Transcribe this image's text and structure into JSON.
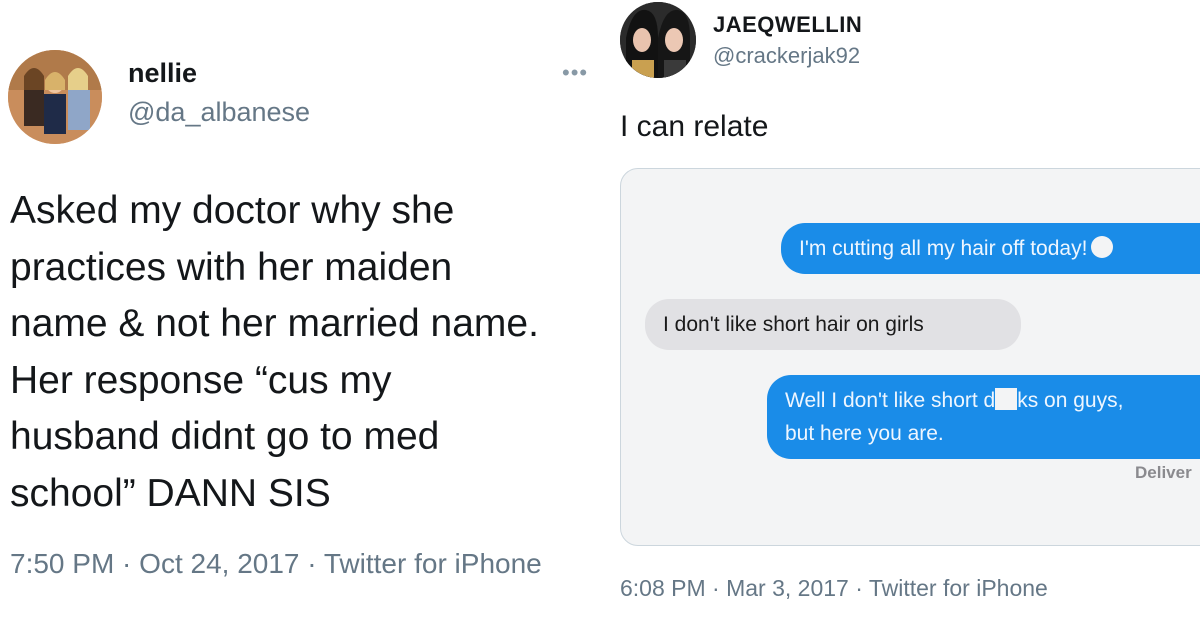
{
  "left_tweet": {
    "display_name": "nellie",
    "handle": "@da_albanese",
    "more_label": "•••",
    "body": "Asked my doctor why she\npractices with her maiden\nname & not her married name.\nHer response “cus my\nhusband didnt go to med\nschool” DANN SIS",
    "meta": "7:50 PM · Oct 24, 2017 · Twitter for iPhone"
  },
  "right_tweet": {
    "display_name": "JAEQWELLIN",
    "handle": "@crackerjak92",
    "body": "I can relate",
    "meta": "6:08 PM · Mar 3, 2017 · Twitter for iPhone",
    "screenshot": {
      "message_1": "I'm cutting all my hair off today!",
      "message_1_emoji": "smiley-emoji",
      "message_2": "I don't like short hair on girls",
      "message_3_part_a": "Well I don't like short d",
      "message_3_part_b": "ks on guys,",
      "message_3_line_2": "but here you are.",
      "status": "Deliver"
    }
  },
  "colors": {
    "handle_gray": "#657786",
    "outgoing_bubble": "#1a8ce8",
    "incoming_bubble": "#e1e1e4",
    "card_border": "#ccd6dd"
  }
}
